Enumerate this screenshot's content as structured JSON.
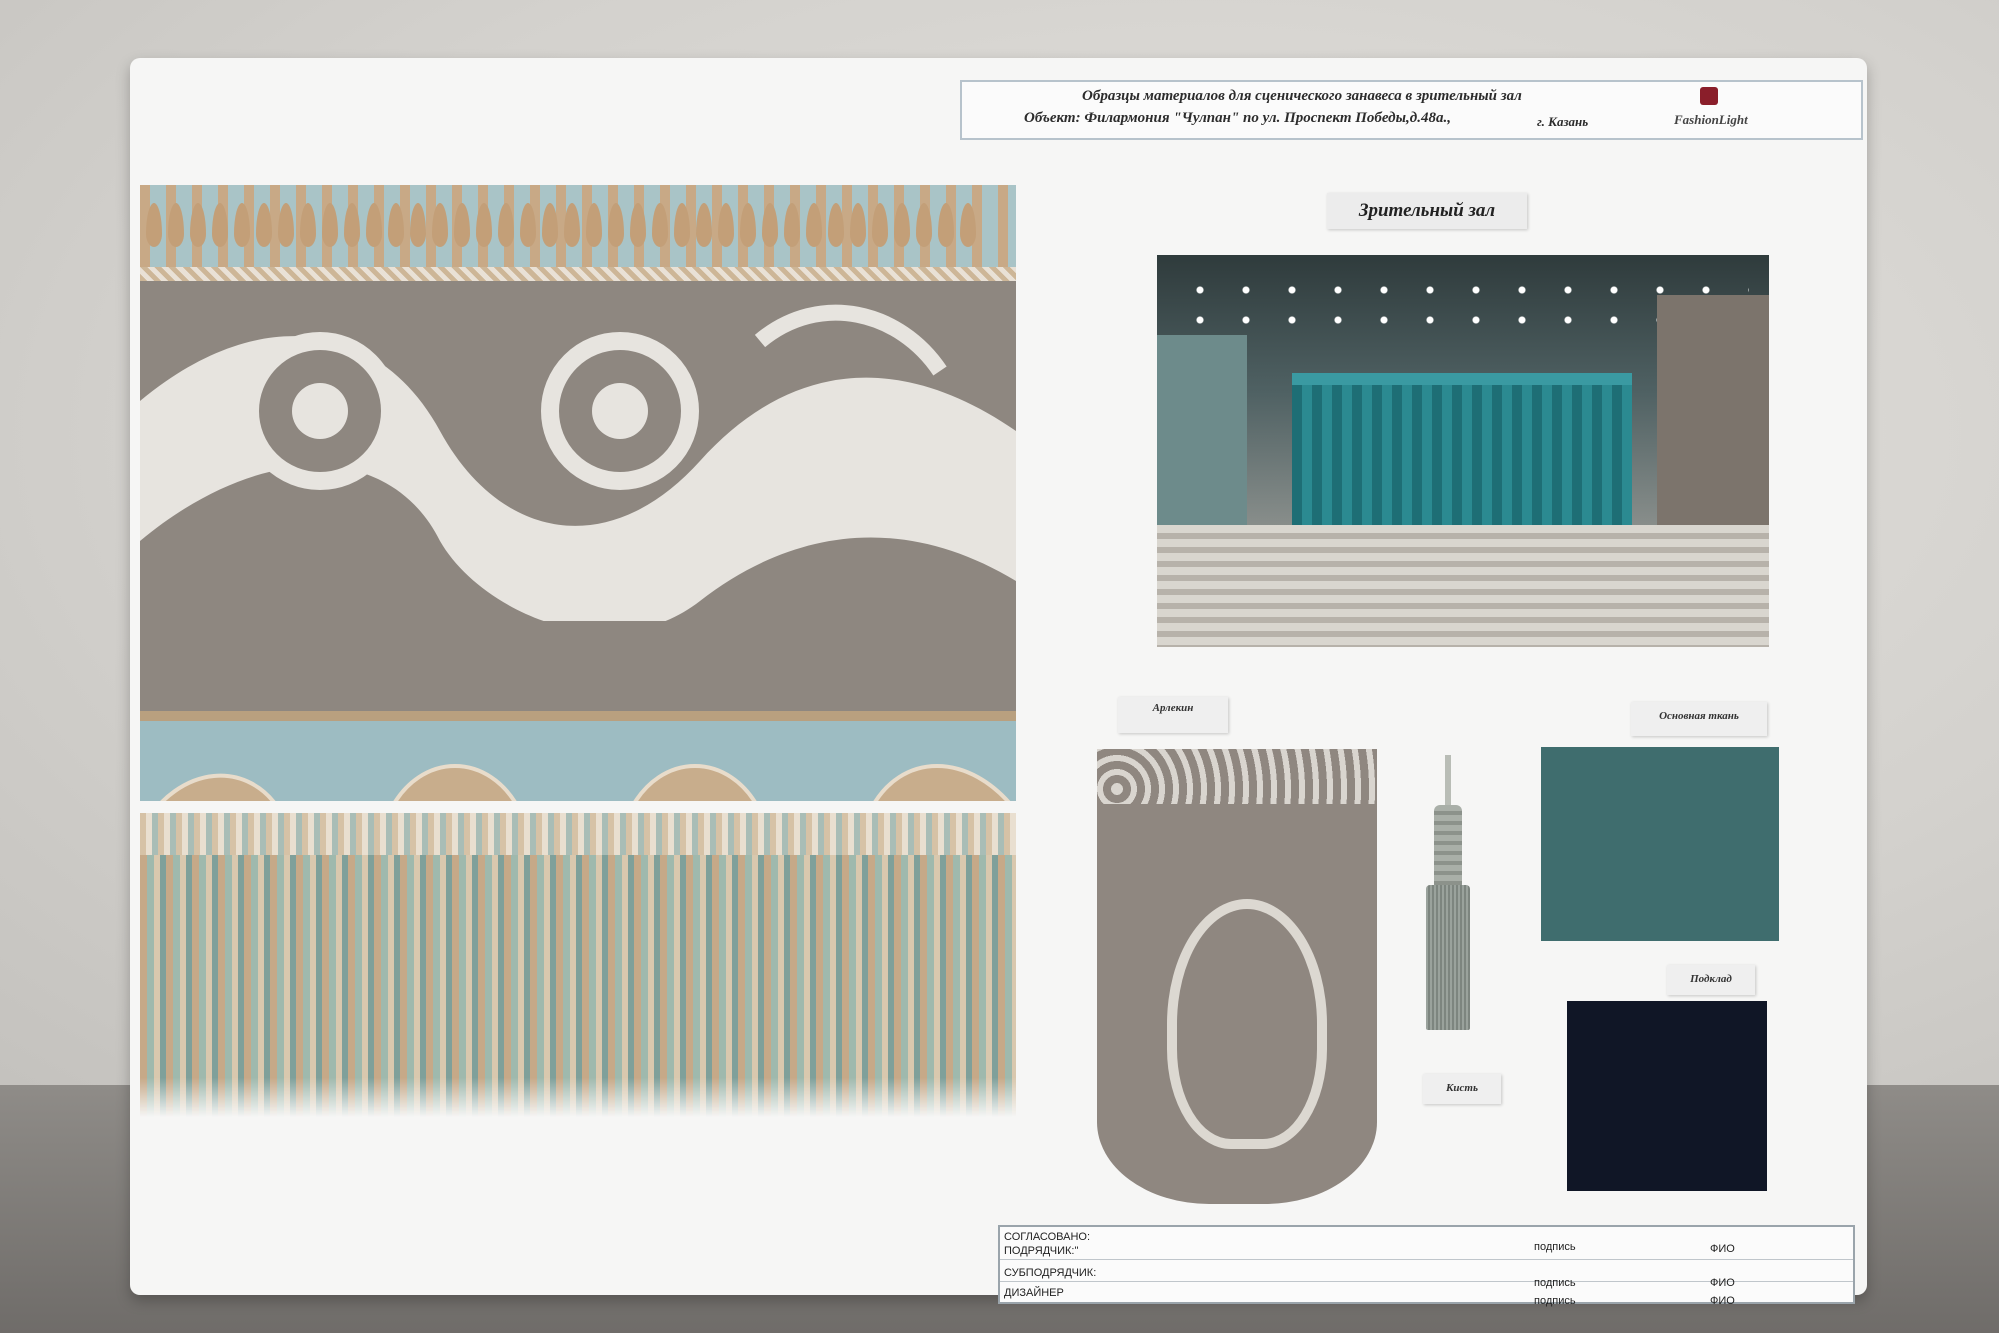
{
  "header": {
    "line1": "Образцы материалов для сценического занавеса в зрительный зал",
    "line2": "Объект:  Филармония \"Чулпан\" по ул. Проспект Победы,д.48а.,",
    "city": "г. Казань",
    "logo": "FashionLight"
  },
  "hall_title": "Зрительный   зал",
  "labels": {
    "harlequin": "Арлекин",
    "main_fabric": "Основная ткань",
    "lining": "Подклад",
    "tassel": "Кисть"
  },
  "signatures": {
    "agreed": "СОГЛАСОВАНО:",
    "contractor": "ПОДРЯДЧИК:\"",
    "subcontractor": "СУБПОДРЯДЧИК:",
    "designer": "ДИЗАЙНЕР",
    "sign": "подпись",
    "name": "ФИО"
  },
  "colors": {
    "main_fabric": "#3f6d6e",
    "lining": "#101626",
    "logo": "#8a1e2a"
  }
}
